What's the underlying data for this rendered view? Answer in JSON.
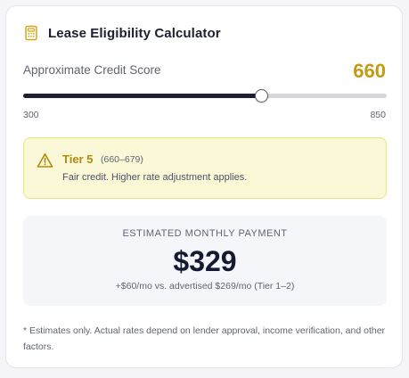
{
  "header": {
    "title": "Lease Eligibility Calculator",
    "icon": "calculator-icon",
    "icon_color": "#d4a514"
  },
  "credit_score": {
    "label": "Approximate Credit Score",
    "value": "660",
    "value_number": 660,
    "min": 300,
    "max": 850,
    "min_label": "300",
    "max_label": "850",
    "accent_color": "#c39a14"
  },
  "tier": {
    "icon": "warning-triangle-icon",
    "name": "Tier 5",
    "range": "(660–679)",
    "description": "Fair credit. Higher rate adjustment applies.",
    "background_color": "#fbf8d8",
    "border_color": "#ece27f"
  },
  "payment": {
    "label": "ESTIMATED MONTHLY PAYMENT",
    "value": "$329",
    "note": "+$60/mo vs. advertised $269/mo (Tier 1–2)"
  },
  "disclaimer": "* Estimates only. Actual rates depend on lender approval, income verification, and other factors."
}
